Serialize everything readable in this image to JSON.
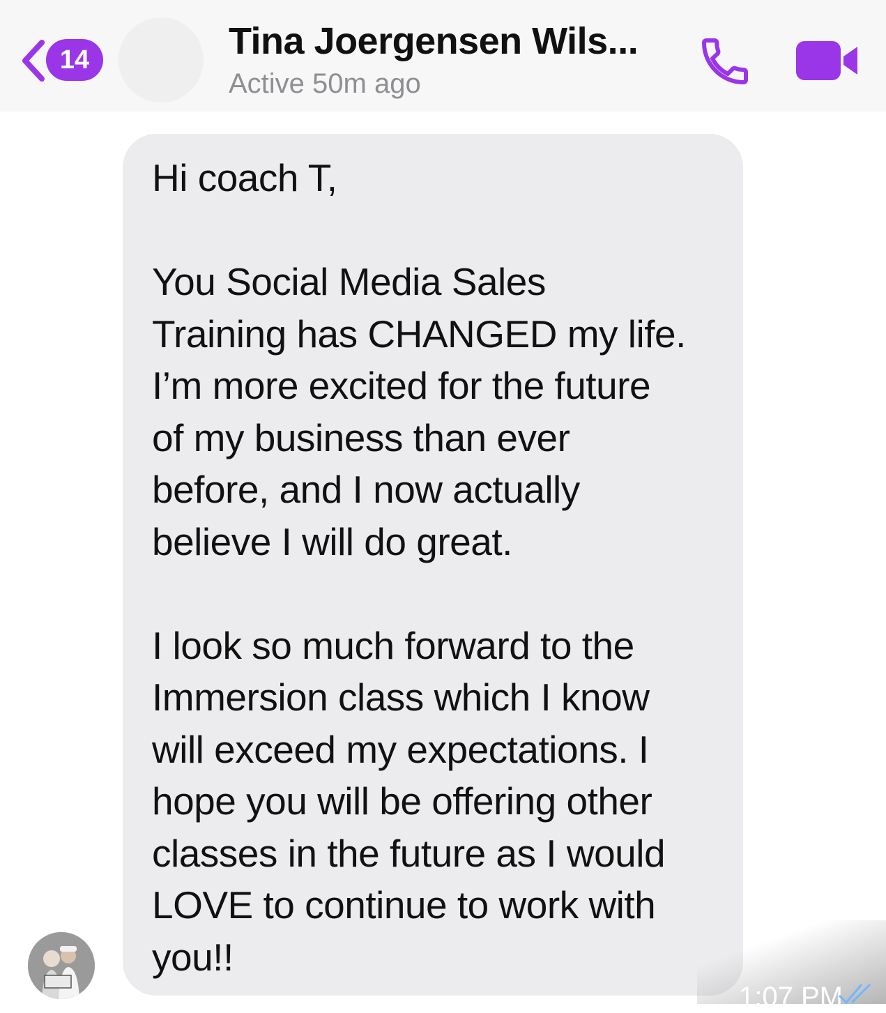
{
  "header": {
    "unread_count": "14",
    "contact_name": "Tina Joergensen Wils...",
    "status": "Active 50m ago",
    "accent_color": "#9b35e8",
    "icons": [
      "back-chevron-icon",
      "phone-icon",
      "video-camera-icon"
    ]
  },
  "message": {
    "paragraphs": [
      [
        "Hi coach T,"
      ],
      [
        "You Social Media Sales",
        "Training has CHANGED my life.",
        "I’m more excited for the future",
        "of my business than ever",
        "before, and I now actually",
        "believe I will do great."
      ],
      [
        "I look so much forward to the",
        "Immersion class which I know",
        "will exceed my expectations. I",
        "hope you will be offering other",
        "classes in the future as I would",
        "LOVE to continue to work with",
        "you!!"
      ]
    ],
    "timestamp": "1:07 PM",
    "bubble_color": "#ececee"
  }
}
